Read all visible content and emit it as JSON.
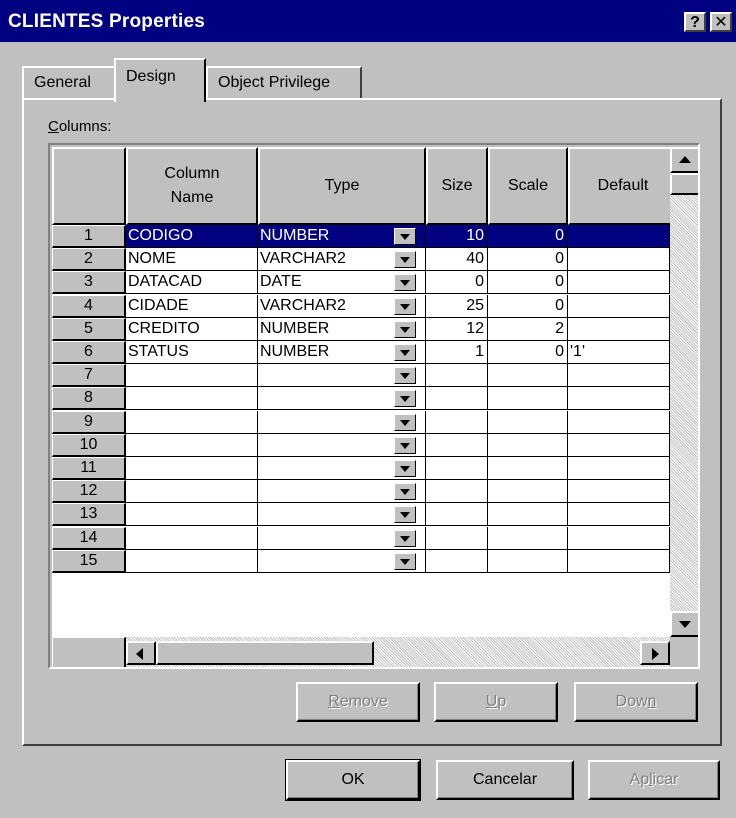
{
  "window": {
    "title": "CLIENTES Properties",
    "help_glyph": "?",
    "close_glyph": "✕"
  },
  "tabs": [
    {
      "label": "General",
      "active": false
    },
    {
      "label": "Design",
      "active": true
    },
    {
      "label": "Object Privilege",
      "active": false
    }
  ],
  "columns_label": {
    "accel": "C",
    "rest": "olumns:"
  },
  "grid": {
    "headers": {
      "column_name_1": "Column",
      "column_name_2": "Name",
      "type": "Type",
      "size": "Size",
      "scale": "Scale",
      "default": "Default"
    },
    "rows": [
      {
        "num": "1",
        "name": "CODIGO",
        "type": "NUMBER",
        "size": "10",
        "scale": "0",
        "default": ""
      },
      {
        "num": "2",
        "name": "NOME",
        "type": "VARCHAR2",
        "size": "40",
        "scale": "0",
        "default": ""
      },
      {
        "num": "3",
        "name": "DATACAD",
        "type": "DATE",
        "size": "0",
        "scale": "0",
        "default": ""
      },
      {
        "num": "4",
        "name": "CIDADE",
        "type": "VARCHAR2",
        "size": "25",
        "scale": "0",
        "default": ""
      },
      {
        "num": "5",
        "name": "CREDITO",
        "type": "NUMBER",
        "size": "12",
        "scale": "2",
        "default": ""
      },
      {
        "num": "6",
        "name": "STATUS",
        "type": "NUMBER",
        "size": "1",
        "scale": "0",
        "default": "'1'"
      },
      {
        "num": "7",
        "name": "",
        "type": "",
        "size": "",
        "scale": "",
        "default": ""
      },
      {
        "num": "8",
        "name": "",
        "type": "",
        "size": "",
        "scale": "",
        "default": ""
      },
      {
        "num": "9",
        "name": "",
        "type": "",
        "size": "",
        "scale": "",
        "default": ""
      },
      {
        "num": "10",
        "name": "",
        "type": "",
        "size": "",
        "scale": "",
        "default": ""
      },
      {
        "num": "11",
        "name": "",
        "type": "",
        "size": "",
        "scale": "",
        "default": ""
      },
      {
        "num": "12",
        "name": "",
        "type": "",
        "size": "",
        "scale": "",
        "default": ""
      },
      {
        "num": "13",
        "name": "",
        "type": "",
        "size": "",
        "scale": "",
        "default": ""
      },
      {
        "num": "14",
        "name": "",
        "type": "",
        "size": "",
        "scale": "",
        "default": ""
      },
      {
        "num": "15",
        "name": "",
        "type": "",
        "size": "",
        "scale": "",
        "default": ""
      }
    ],
    "selected_row": 0
  },
  "grid_buttons": {
    "remove": {
      "accel": "R",
      "rest": "emove"
    },
    "up": {
      "accel": "U",
      "rest": "p"
    },
    "down": {
      "pre": "Dow",
      "accel": "n"
    }
  },
  "dialog_buttons": {
    "ok": "OK",
    "cancel": "Cancelar",
    "apply_pre": "Ap",
    "apply_accel": "l",
    "apply_rest": "icar"
  },
  "colors": {
    "face": "#c0c0c0",
    "titlebar": "#000080",
    "selection": "#000080"
  }
}
